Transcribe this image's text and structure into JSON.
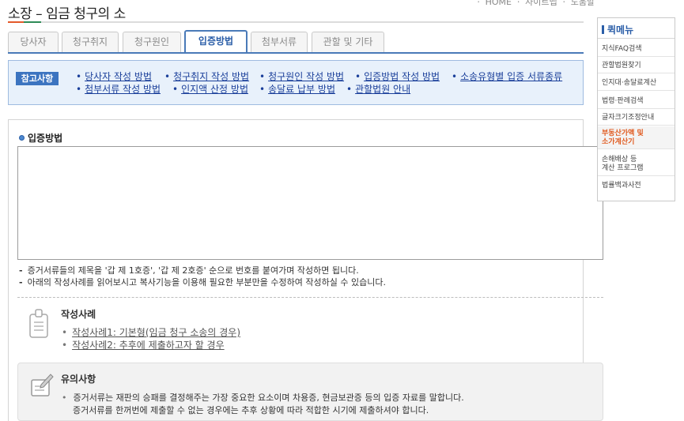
{
  "header": {
    "top_clipped": "ㆍ HOME ㆍ 사이트맵 ㆍ 도움말",
    "title": "소장 – 임금 청구의 소"
  },
  "tabs": [
    {
      "label": "당사자",
      "active": false
    },
    {
      "label": "청구취지",
      "active": false
    },
    {
      "label": "청구원인",
      "active": false
    },
    {
      "label": "입증방법",
      "active": true
    },
    {
      "label": "첨부서류",
      "active": false
    },
    {
      "label": "관할 및 기타",
      "active": false
    }
  ],
  "reference": {
    "badge": "참고사항",
    "links": [
      "당사자 작성 방법",
      "청구취지 작성 방법",
      "청구원인 작성 방법",
      "입증방법 작성 방법",
      "소송유형별 입증 서류종류",
      "첨부서류 작성 방법",
      "인지액 산정 방법",
      "송달료 납부 방법",
      "관할법원 안내"
    ]
  },
  "section": {
    "title": "입증방법",
    "textarea_value": "",
    "notes": [
      "증거서류들의 제목을 '갑 제 1호증', '갑 제 2호증' 순으로 번호를 붙여가며 작성하면 됩니다.",
      "아래의 작성사례를 읽어보시고 복사기능을 이용해 필요한 부분만을 수정하여 작성하실 수 있습니다."
    ]
  },
  "samples": {
    "title": "작성사례",
    "links": [
      "작성사례1: 기본형(임금 청구 소송의 경우)",
      "작성사례2: 추후에 제출하고자 할 경우"
    ]
  },
  "caution": {
    "title": "유의사항",
    "lines": [
      "증거서류는 재판의 승패를 결정해주는 가장 중요한 요소이며 차용증, 현금보관증 등의 입증 자료를 말합니다.",
      "증거서류를 한꺼번에 제출할 수 없는 경우에는 추후 상황에 따라 적합한 시기에 제출하셔야 합니다."
    ]
  },
  "quick_menu": {
    "title": "퀵메뉴",
    "items": [
      {
        "label": "지식FAQ검색",
        "highlight": false
      },
      {
        "label": "관할법원찾기",
        "highlight": false
      },
      {
        "label": "인지대·송달료계산",
        "highlight": false
      },
      {
        "label": "법령·판례검색",
        "highlight": false
      },
      {
        "label": "글자크기조정안내",
        "highlight": false
      },
      {
        "label": "부동산가액 및\n소가계산기",
        "highlight": true
      },
      {
        "label": "손해배상 등\n계산 프로그램",
        "highlight": false
      },
      {
        "label": "법률백과사전",
        "highlight": false
      }
    ]
  },
  "colors": {
    "accent": "#2b5ea8",
    "tab_border": "#4a7ab8",
    "ref_bg": "#e8f1fb",
    "highlight": "#e05a1f"
  }
}
